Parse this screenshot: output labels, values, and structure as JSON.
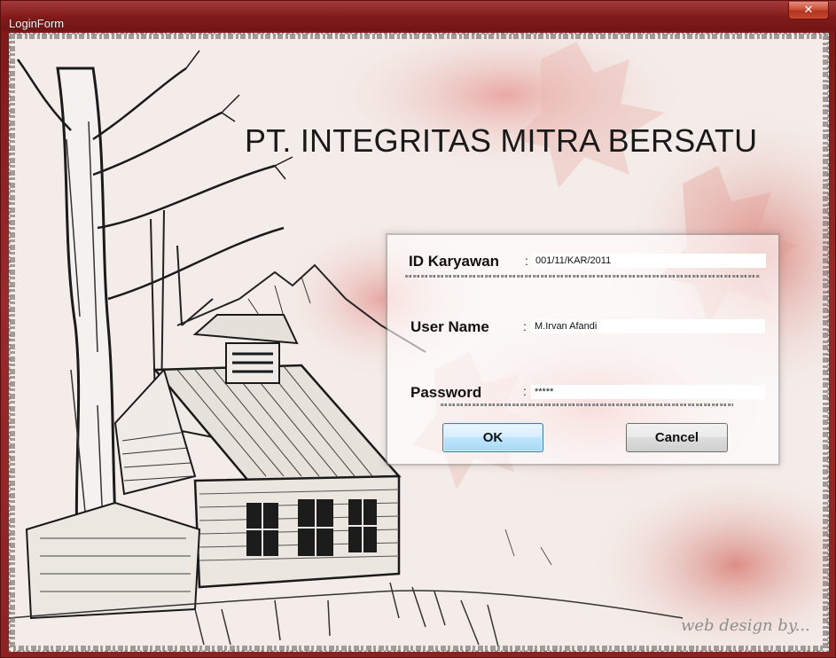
{
  "window": {
    "title": "LoginForm"
  },
  "header": {
    "company_name": "PT. INTEGRITAS MITRA BERSATU"
  },
  "form": {
    "id_label": "ID Karyawan",
    "id_value": "001/11/KAR/2011",
    "username_label": "User Name",
    "username_value": "M.Irvan Afandi",
    "password_label": "Password",
    "password_value": "*****",
    "colon": ":"
  },
  "buttons": {
    "ok_label": "OK",
    "cancel_label": "Cancel"
  },
  "footer": {
    "watermark": "web design by..."
  },
  "colors": {
    "titlebar": "#7f1a1a",
    "close_button": "#c9503a",
    "background": "#f3e9e5",
    "ok_button": "#bee6fd"
  },
  "icons": {
    "close": "close-icon"
  }
}
